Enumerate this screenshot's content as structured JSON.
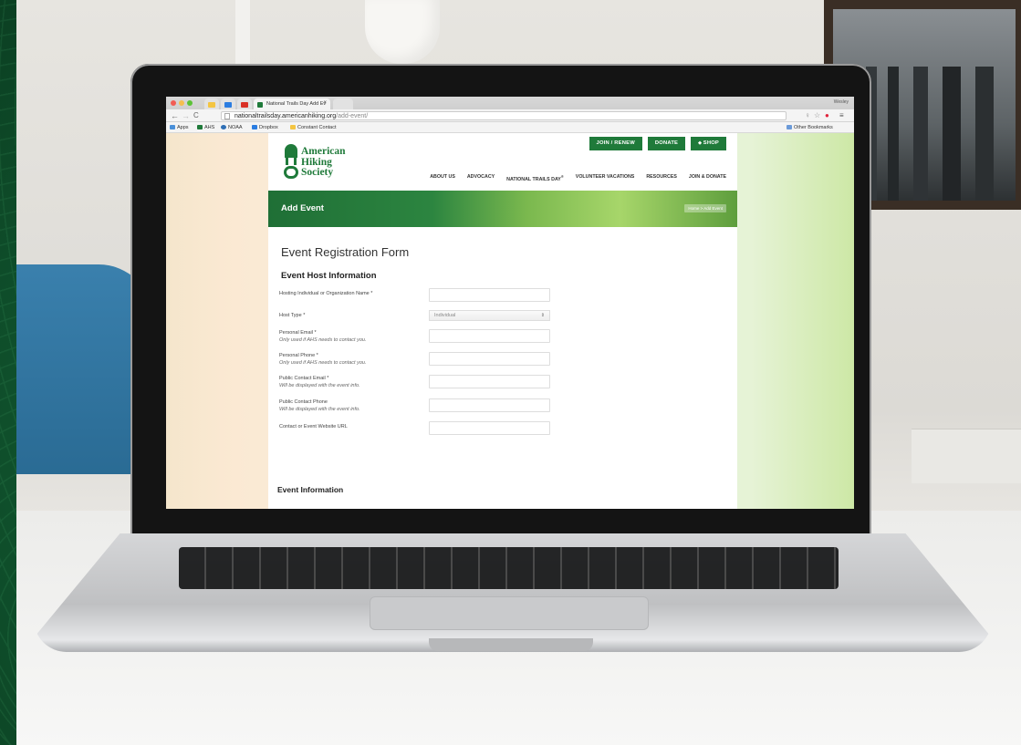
{
  "browser": {
    "tabs": [
      {
        "label": ""
      },
      {
        "label": ""
      },
      {
        "label": ""
      },
      {
        "label": "National Trails Day Add Ev"
      },
      {
        "label": ""
      }
    ],
    "window_user": "Wesley",
    "url_host": "nationaltrailsday.americanhiking.org",
    "url_path": "/add-event/",
    "bookmarks": [
      "Apps",
      "AHS",
      "NOAA",
      "Dropbox",
      "Constant Contact"
    ],
    "other_bookmarks": "Other Bookmarks"
  },
  "site": {
    "logo_lines": [
      "American",
      "Hiking",
      "Society"
    ],
    "top_buttons": {
      "join": "JOIN / RENEW",
      "donate": "DONATE",
      "shop": "SHOP"
    },
    "nav": {
      "about": "ABOUT US",
      "advocacy": "ADVOCACY",
      "ntd": "NATIONAL TRAILS DAY",
      "ntd_mark": "®",
      "volunteer": "VOLUNTEER VACATIONS",
      "resources": "RESOURCES",
      "join": "JOIN & DONATE"
    },
    "banner_title": "Add Event",
    "breadcrumb": "Home > Add Event"
  },
  "form": {
    "title": "Event Registration Form",
    "host_section": "Event Host Information",
    "fields": [
      {
        "label": "Hosting Individual or Organization Name *",
        "note": "",
        "type": "text",
        "value": ""
      },
      {
        "label": "Host Type *",
        "note": "",
        "type": "select",
        "value": "Individual"
      },
      {
        "label": "Personal Email *",
        "note": "Only used if AHS needs to contact you.",
        "type": "text",
        "value": ""
      },
      {
        "label": "Personal Phone *",
        "note": "Only used if AHS needs to contact you.",
        "type": "text",
        "value": ""
      },
      {
        "label": "Public Contact Email *",
        "note": "Will be displayed with the event info.",
        "type": "text",
        "value": ""
      },
      {
        "label": "Public Contact Phone",
        "note": "Will be displayed with the event info.",
        "type": "text",
        "value": ""
      },
      {
        "label": "Contact or Event Website URL",
        "note": "",
        "type": "text",
        "value": ""
      }
    ],
    "event_section": "Event Information"
  },
  "colors": {
    "brand_green": "#1f7a3a",
    "background_green": "#0f4f2b"
  }
}
